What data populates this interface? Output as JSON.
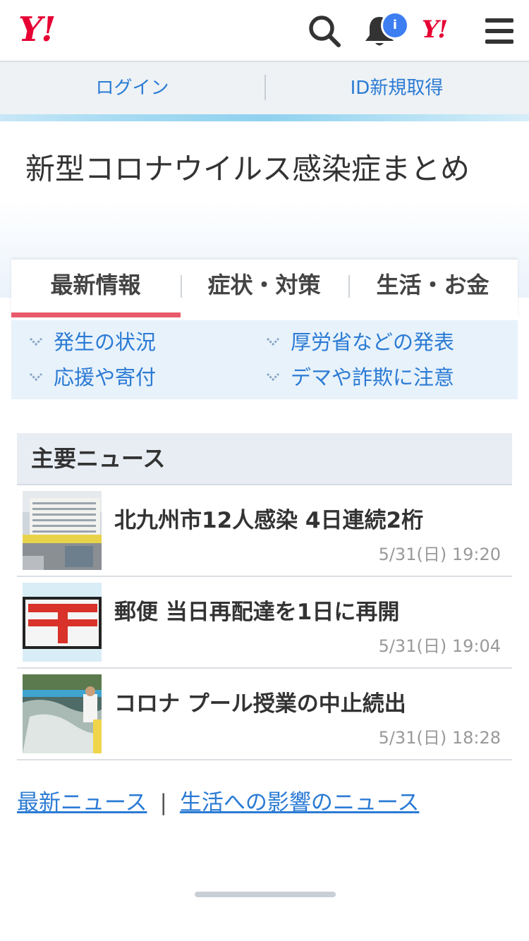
{
  "header": {
    "logo": "Y!",
    "badge_logo": "Y!",
    "notification_count": "i",
    "icons": [
      "search-icon",
      "bell-icon",
      "menu-icon"
    ]
  },
  "auth": {
    "login": "ログイン",
    "signup": "ID新規取得"
  },
  "page_title": "新型コロナウイルス感染症まとめ",
  "tabs": [
    {
      "label": "最新情報",
      "active": true
    },
    {
      "label": "症状・対策",
      "active": false
    },
    {
      "label": "生活・お金",
      "active": false
    }
  ],
  "sublinks": [
    "発生の状況",
    "厚労省などの発表",
    "応援や寄付",
    "デマや詐欺に注意"
  ],
  "news": {
    "heading": "主要ニュース",
    "items": [
      {
        "headline": "北九州市12人感染 4日連続2桁",
        "time": "5/31(日) 19:20"
      },
      {
        "headline": "郵便 当日再配達を1日に再開",
        "time": "5/31(日) 19:04"
      },
      {
        "headline": "コロナ プール授業の中止続出",
        "time": "5/31(日) 18:28"
      }
    ]
  },
  "footer_links": {
    "latest": "最新ニュース",
    "separator": "|",
    "impact": "生活への影響のニュース"
  },
  "colors": {
    "brand_red": "#e60033",
    "link_blue": "#2b7bd4",
    "tab_active": "#e85a6a",
    "badge_blue": "#3d7ef2"
  }
}
